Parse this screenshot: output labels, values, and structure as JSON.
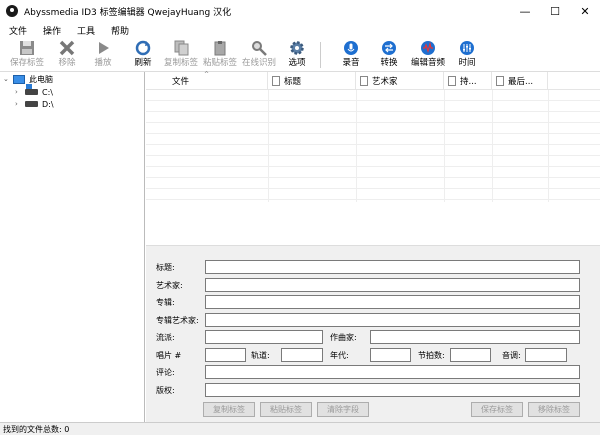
{
  "window": {
    "title": "Abyssmedia ID3 标签编辑器 QwejayHuang 汉化",
    "minimize": "—",
    "maximize": "☐",
    "close": "✕"
  },
  "menu": [
    "文件",
    "操作",
    "工具",
    "帮助"
  ],
  "toolbar": {
    "save_tag": "保存标签",
    "remove": "移除",
    "play": "播放",
    "refresh": "刷新",
    "copy_tag": "复制标签",
    "paste_tag": "粘贴标签",
    "online_identify": "在线识别",
    "options": "选项",
    "record": "录音",
    "convert": "转换",
    "edit_audio": "编辑音频",
    "time": "时间"
  },
  "tree": {
    "root": "此电脑",
    "drives": [
      "C:\\",
      "D:\\"
    ]
  },
  "columns": [
    "文件",
    "标题",
    "艺术家",
    "持...",
    "最后..."
  ],
  "editor": {
    "title_label": "标题:",
    "artist_label": "艺术家:",
    "album_label": "专辑:",
    "album_artist_label": "专辑艺术家:",
    "genre_label": "流派:",
    "composer_label": "作曲家:",
    "disc_label": "唱片 #",
    "track_label": "轨道:",
    "year_label": "年代:",
    "bpm_label": "节拍数:",
    "key_label": "音调:",
    "comment_label": "评论:",
    "copyright_label": "版权:"
  },
  "buttons": {
    "copy_tag": "复制标签",
    "paste_tag": "粘贴标签",
    "clear_fields": "清除字段",
    "save_tag": "保存标签",
    "remove_tag": "移除标签"
  },
  "status": {
    "text": "找到的文件总数: 0"
  }
}
